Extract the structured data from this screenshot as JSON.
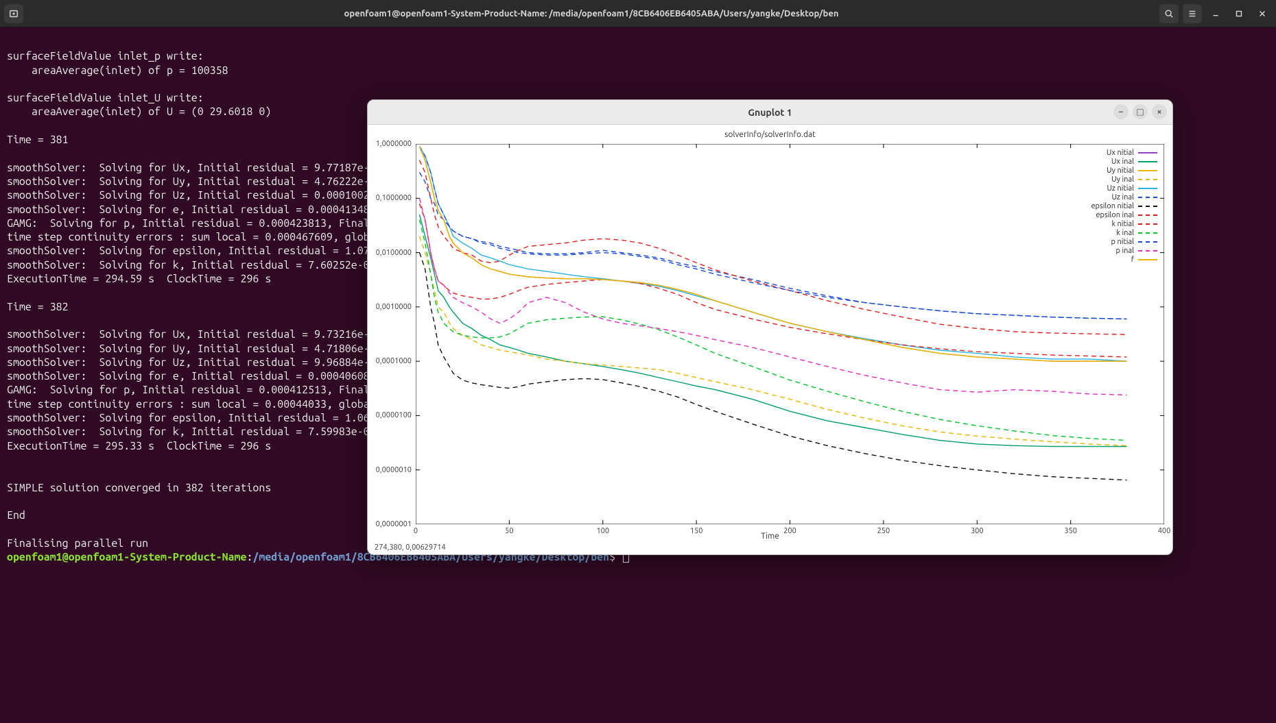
{
  "topbar": {
    "title": "openfoam1@openfoam1-System-Product-Name: /media/openfoam1/8CB6406EB6405ABA/Users/yangke/Desktop/ben"
  },
  "terminal": {
    "lines": [
      "",
      "surfaceFieldValue inlet_p write:",
      "    areaAverage(inlet) of p = 100358",
      "",
      "surfaceFieldValue inlet_U write:",
      "    areaAverage(inlet) of U = (0 29.6018 0)",
      "",
      "Time = 381",
      "",
      "smoothSolver:  Solving for Ux, Initial residual = 9.77187e-",
      "smoothSolver:  Solving for Uy, Initial residual = 4.76222e-",
      "smoothSolver:  Solving for Uz, Initial residual = 0.0001002",
      "smoothSolver:  Solving for e, Initial residual = 0.00041348",
      "GAMG:  Solving for p, Initial residual = 0.000423813, Final",
      "time step continuity errors : sum local = 0.000467609, glob",
      "smoothSolver:  Solving for epsilon, Initial residual = 1.07",
      "smoothSolver:  Solving for k, Initial residual = 7.60252e-0",
      "ExecutionTime = 294.59 s  ClockTime = 296 s",
      "",
      "Time = 382",
      "",
      "smoothSolver:  Solving for Ux, Initial residual = 9.73216e-",
      "smoothSolver:  Solving for Uy, Initial residual = 4.71806e-",
      "smoothSolver:  Solving for Uz, Initial residual = 9.96884e-",
      "smoothSolver:  Solving for e, Initial residual = 0.00040608",
      "GAMG:  Solving for p, Initial residual = 0.000412513, Final",
      "time step continuity errors : sum local = 0.00044033, globa",
      "smoothSolver:  Solving for epsilon, Initial residual = 1.06",
      "smoothSolver:  Solving for k, Initial residual = 7.59983e-0",
      "ExecutionTime = 295.33 s  ClockTime = 296 s",
      "",
      "",
      "SIMPLE solution converged in 382 iterations",
      "",
      "End",
      "",
      "Finalising parallel run"
    ],
    "prompt_user": "openfoam1@openfoam1-System-Product-Name",
    "prompt_colon": ":",
    "prompt_path": "/media/openfoam1/8CB6406EB6405ABA/Users/yangke/Desktop/ben",
    "prompt_dollar": "$ "
  },
  "gnuplot": {
    "window_title": "Gnuplot 1",
    "chart_title": "solverInfo/solverInfo.dat",
    "xlabel": "Time",
    "status": "274,380,  0,00629714"
  },
  "chart_data": {
    "type": "line",
    "title": "solverInfo/solverInfo.dat",
    "xlabel": "Time",
    "ylabel": "",
    "xlim": [
      0,
      400
    ],
    "ylim": [
      1e-07,
      1.0
    ],
    "yscale": "log",
    "xticks": [
      0,
      50,
      100,
      150,
      200,
      250,
      300,
      350,
      400
    ],
    "ytick_labels": [
      "1,0000000",
      "0,1000000",
      "0,0100000",
      "0,0010000",
      "0,0001000",
      "0,0000100",
      "0,0000010",
      "0,0000001"
    ],
    "ytick_values": [
      1.0,
      0.1,
      0.01,
      0.001,
      0.0001,
      1e-05,
      1e-06,
      1e-07
    ],
    "x": [
      2,
      5,
      8,
      10,
      12,
      15,
      18,
      20,
      25,
      30,
      35,
      40,
      45,
      50,
      55,
      60,
      70,
      80,
      90,
      100,
      110,
      120,
      130,
      140,
      150,
      160,
      180,
      200,
      220,
      240,
      260,
      280,
      300,
      320,
      340,
      360,
      380
    ],
    "series": [
      {
        "name": "Ux nitial",
        "color": "#933dc7",
        "dash": "solid",
        "values": [
          0.9,
          0.5,
          0.2,
          0.1,
          0.06,
          0.04,
          0.02,
          0.015,
          0.01,
          0.008,
          0.006,
          0.005,
          0.0045,
          0.004,
          0.0038,
          0.0036,
          0.0034,
          0.0033,
          0.0033,
          0.0032,
          0.003,
          0.0028,
          0.0025,
          0.0021,
          0.0017,
          0.0013,
          0.0008,
          0.0005,
          0.00035,
          0.00025,
          0.00018,
          0.00014,
          0.00012,
          0.00011,
          0.0001,
          0.0001,
          0.0001
        ]
      },
      {
        "name": "Ux inal",
        "color": "#009d6e",
        "dash": "solid",
        "values": [
          0.05,
          0.02,
          0.008,
          0.004,
          0.002,
          0.0015,
          0.001,
          0.0008,
          0.0005,
          0.0004,
          0.0003,
          0.00025,
          0.0002,
          0.00018,
          0.00016,
          0.00014,
          0.00012,
          0.0001,
          9e-05,
          8e-05,
          7e-05,
          6e-05,
          5e-05,
          4.2e-05,
          3.5e-05,
          3e-05,
          2e-05,
          1.2e-05,
          8e-06,
          6e-06,
          4.5e-06,
          3.5e-06,
          3e-06,
          2.8e-06,
          2.7e-06,
          2.7e-06,
          2.7e-06
        ]
      },
      {
        "name": "Uy nitial",
        "color": "#e8b600",
        "dash": "solid",
        "values": [
          0.9,
          0.5,
          0.2,
          0.1,
          0.06,
          0.04,
          0.02,
          0.015,
          0.01,
          0.008,
          0.006,
          0.005,
          0.0045,
          0.004,
          0.0038,
          0.0036,
          0.0034,
          0.0033,
          0.0033,
          0.0032,
          0.003,
          0.0028,
          0.0025,
          0.0021,
          0.0017,
          0.0013,
          0.0008,
          0.0005,
          0.00035,
          0.00025,
          0.00018,
          0.00014,
          0.00012,
          0.00011,
          0.0001,
          0.0001,
          0.0001
        ]
      },
      {
        "name": "Uy inal",
        "color": "#e8b600",
        "dash": "dashed",
        "values": [
          0.02,
          0.01,
          0.004,
          0.002,
          0.001,
          0.0008,
          0.0005,
          0.0004,
          0.0003,
          0.00025,
          0.0002,
          0.00018,
          0.00016,
          0.00015,
          0.00014,
          0.00013,
          0.00011,
          0.0001,
          9e-05,
          8.5e-05,
          8e-05,
          7.5e-05,
          7e-05,
          6e-05,
          5e-05,
          4.2e-05,
          3e-05,
          2e-05,
          1.3e-05,
          9e-06,
          6.5e-06,
          5e-06,
          4.2e-06,
          3.7e-06,
          3.3e-06,
          3e-06,
          2.8e-06
        ]
      },
      {
        "name": "Uz nitial",
        "color": "#2bb3e0",
        "dash": "solid",
        "values": [
          0.9,
          0.6,
          0.3,
          0.15,
          0.08,
          0.05,
          0.03,
          0.02,
          0.015,
          0.012,
          0.009,
          0.008,
          0.007,
          0.006,
          0.0055,
          0.005,
          0.0045,
          0.004,
          0.0036,
          0.0033,
          0.003,
          0.0027,
          0.0024,
          0.002,
          0.0016,
          0.0013,
          0.0008,
          0.0005,
          0.00035,
          0.00026,
          0.0002,
          0.00016,
          0.00014,
          0.00012,
          0.00011,
          0.00011,
          0.0001
        ]
      },
      {
        "name": "Uz inal",
        "color": "#1a4ad6",
        "dash": "dashed",
        "values": [
          0.3,
          0.2,
          0.1,
          0.08,
          0.05,
          0.04,
          0.03,
          0.025,
          0.02,
          0.018,
          0.016,
          0.015,
          0.013,
          0.012,
          0.011,
          0.01,
          0.0095,
          0.0095,
          0.01,
          0.011,
          0.01,
          0.009,
          0.008,
          0.0065,
          0.0055,
          0.0045,
          0.0032,
          0.0022,
          0.0016,
          0.0012,
          0.001,
          0.00085,
          0.00075,
          0.0007,
          0.00065,
          0.00062,
          0.0006
        ]
      },
      {
        "name": "epsilon nitial",
        "color": "#111111",
        "dash": "dashed",
        "values": [
          0.01,
          0.005,
          0.001,
          0.0005,
          0.0002,
          0.00012,
          8e-05,
          6e-05,
          4.5e-05,
          4e-05,
          3.7e-05,
          3.5e-05,
          3.3e-05,
          3.2e-05,
          3.4e-05,
          3.8e-05,
          4.2e-05,
          4.6e-05,
          4.8e-05,
          4.6e-05,
          4e-05,
          3.4e-05,
          2.8e-05,
          2.2e-05,
          1.6e-05,
          1.2e-05,
          7e-06,
          4.2e-06,
          2.8e-06,
          2e-06,
          1.5e-06,
          1.2e-06,
          1e-06,
          8.5e-07,
          7.5e-07,
          7e-07,
          6.5e-07
        ]
      },
      {
        "name": "epsilon inal",
        "color": "#e01e1e",
        "dash": "dashed",
        "values": [
          0.5,
          0.3,
          0.1,
          0.05,
          0.03,
          0.02,
          0.015,
          0.012,
          0.01,
          0.009,
          0.007,
          0.0065,
          0.007,
          0.009,
          0.011,
          0.013,
          0.014,
          0.015,
          0.017,
          0.018,
          0.017,
          0.015,
          0.012,
          0.009,
          0.0065,
          0.0048,
          0.003,
          0.002,
          0.0013,
          0.0009,
          0.00065,
          0.00048,
          0.0004,
          0.00035,
          0.00033,
          0.00032,
          0.00031
        ]
      },
      {
        "name": "k nitial",
        "color": "#e01e1e",
        "dash": "dashed",
        "values": [
          0.08,
          0.04,
          0.01,
          0.005,
          0.003,
          0.0025,
          0.002,
          0.0018,
          0.0016,
          0.0015,
          0.0014,
          0.0014,
          0.0015,
          0.0017,
          0.002,
          0.0023,
          0.0026,
          0.0028,
          0.003,
          0.0032,
          0.003,
          0.0027,
          0.0022,
          0.0017,
          0.0012,
          0.0009,
          0.0006,
          0.00042,
          0.00032,
          0.00025,
          0.0002,
          0.00017,
          0.00015,
          0.00014,
          0.00013,
          0.000125,
          0.00012
        ]
      },
      {
        "name": "k inal",
        "color": "#00c22a",
        "dash": "dashed",
        "values": [
          0.04,
          0.015,
          0.004,
          0.0015,
          0.0008,
          0.0005,
          0.0004,
          0.00035,
          0.0003,
          0.00028,
          0.00027,
          0.00027,
          0.00028,
          0.00032,
          0.0004,
          0.0005,
          0.00058,
          0.00062,
          0.00065,
          0.00066,
          0.00058,
          0.00048,
          0.00038,
          0.00028,
          0.0002,
          0.00014,
          8e-05,
          4.5e-05,
          2.8e-05,
          1.8e-05,
          1.2e-05,
          8.5e-06,
          6.5e-06,
          5.2e-06,
          4.3e-06,
          3.8e-06,
          3.5e-06
        ]
      },
      {
        "name": "p nitial",
        "color": "#1a4ad6",
        "dash": "dashed",
        "values": [
          0.9,
          0.6,
          0.3,
          0.15,
          0.08,
          0.05,
          0.03,
          0.025,
          0.02,
          0.018,
          0.015,
          0.014,
          0.012,
          0.011,
          0.01,
          0.0095,
          0.009,
          0.009,
          0.0095,
          0.01,
          0.0095,
          0.0085,
          0.0075,
          0.006,
          0.005,
          0.004,
          0.0028,
          0.002,
          0.0015,
          0.0012,
          0.001,
          0.00085,
          0.00075,
          0.0007,
          0.00065,
          0.00062,
          0.0006
        ]
      },
      {
        "name": "p inal",
        "color": "#e82ac2",
        "dash": "dashed",
        "values": [
          0.1,
          0.04,
          0.01,
          0.005,
          0.003,
          0.0025,
          0.0018,
          0.0015,
          0.0012,
          0.001,
          0.0008,
          0.0006,
          0.0005,
          0.0006,
          0.0008,
          0.0012,
          0.0015,
          0.0012,
          0.0008,
          0.0006,
          0.0005,
          0.00045,
          0.0004,
          0.00035,
          0.0003,
          0.00025,
          0.00018,
          0.00012,
          8e-05,
          5.5e-05,
          4e-05,
          3e-05,
          2.7e-05,
          3e-05,
          2.8e-05,
          2.5e-05,
          2.4e-05
        ]
      },
      {
        "name": "f",
        "color": "#e8b600",
        "dash": "solid",
        "values": [
          0.9,
          0.5,
          0.2,
          0.1,
          0.06,
          0.04,
          0.02,
          0.015,
          0.01,
          0.008,
          0.006,
          0.005,
          0.0045,
          0.004,
          0.0038,
          0.0036,
          0.0034,
          0.0033,
          0.0033,
          0.0032,
          0.003,
          0.0028,
          0.0025,
          0.0021,
          0.0017,
          0.0013,
          0.0008,
          0.0005,
          0.00035,
          0.00025,
          0.00018,
          0.00014,
          0.00012,
          0.00011,
          0.0001,
          0.0001,
          0.0001
        ]
      }
    ]
  }
}
